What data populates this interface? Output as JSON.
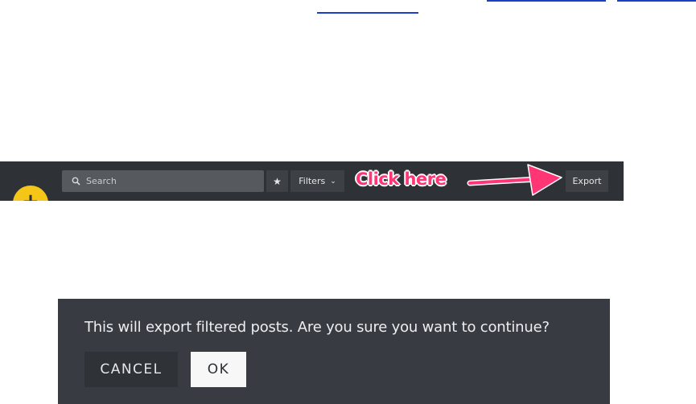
{
  "toolbar": {
    "fab_glyph": "+",
    "search_placeholder": "Search",
    "star_glyph": "★",
    "filters_label": "Filters",
    "filters_chevron": "⌄",
    "annotation_text": "Click here",
    "export_label": "Export"
  },
  "dialog": {
    "message": "This will export filtered posts. Are you sure you want to continue?",
    "cancel_label": "CANCEL",
    "ok_label": "OK"
  },
  "colors": {
    "toolbar_bg": "#2e3236",
    "fab_yellow": "#f5c518",
    "annotation_pink": "#ff3575",
    "dialog_bg": "#383c42",
    "link_blue": "#1a3fc4"
  }
}
